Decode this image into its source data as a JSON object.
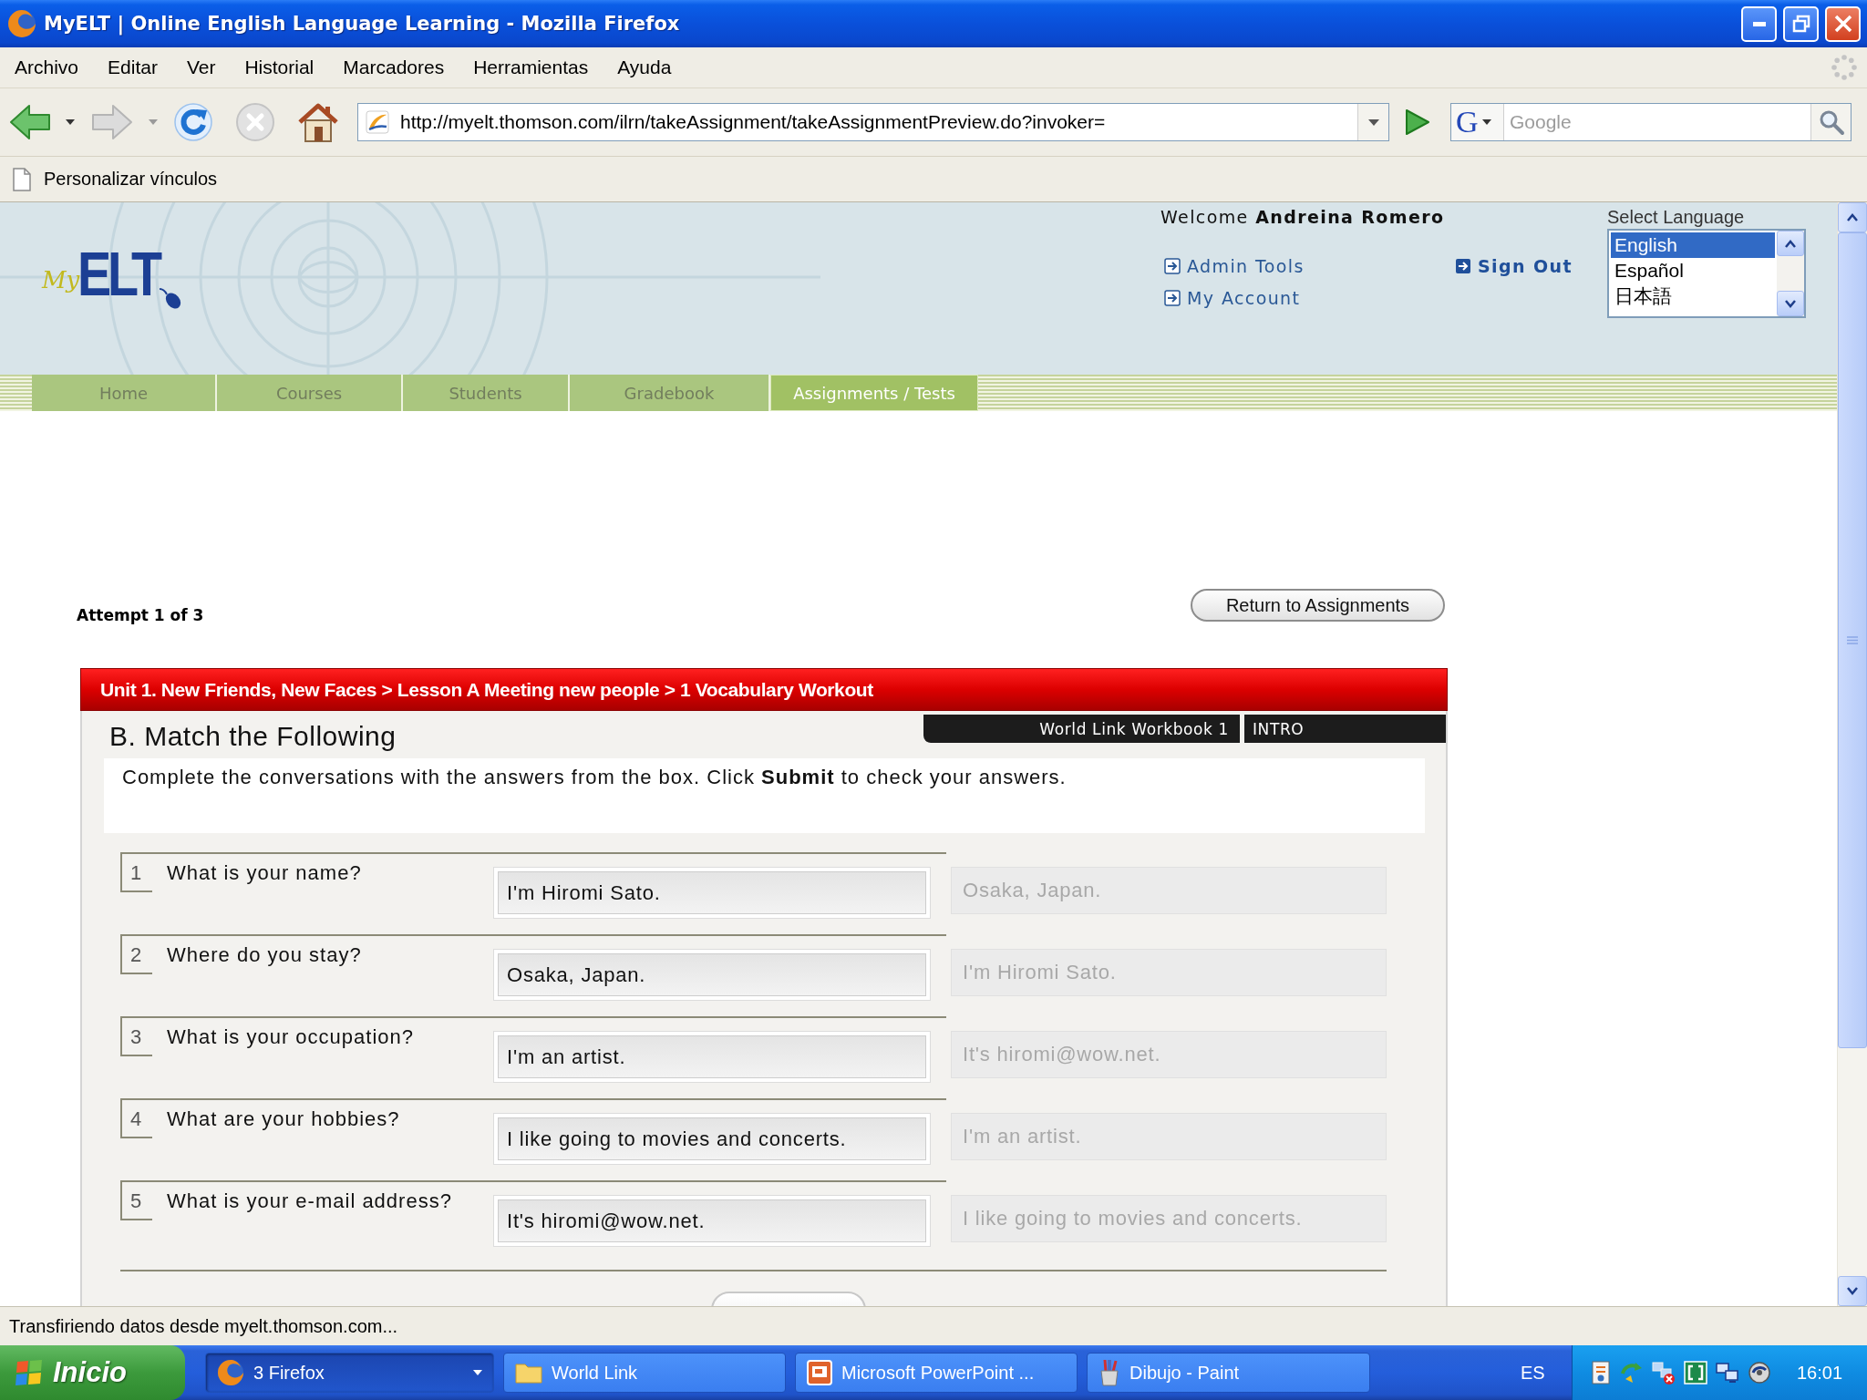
{
  "window": {
    "title": "MyELT | Online English Language Learning - Mozilla Firefox"
  },
  "menu_bar": [
    "Archivo",
    "Editar",
    "Ver",
    "Historial",
    "Marcadores",
    "Herramientas",
    "Ayuda"
  ],
  "toolbar": {
    "url": "http://myelt.thomson.com/ilrn/takeAssignment/takeAssignmentPreview.do?invoker=",
    "search_engine_logo": "G",
    "search_placeholder": "Google"
  },
  "bookmarks_bar": [
    "Personalizar vínculos"
  ],
  "site": {
    "logo": {
      "prefix": "My",
      "name": "ELT"
    },
    "welcome": "Welcome **Andreina Romero**",
    "links": [
      "Admin Tools",
      "My Account"
    ],
    "sign_out": "Sign Out",
    "language": {
      "label": "Select Language",
      "options": [
        {
          "label": "English",
          "selected": true
        },
        {
          "label": "Español",
          "selected": false
        },
        {
          "label": "日本語",
          "selected": false
        }
      ]
    },
    "nav_tabs": [
      {
        "label": "Home",
        "selected": false
      },
      {
        "label": "Courses",
        "selected": false
      },
      {
        "label": "Students",
        "selected": false
      },
      {
        "label": "Gradebook",
        "selected": false
      },
      {
        "label": "Assignments / Tests",
        "selected": true
      }
    ]
  },
  "attempt": "Attempt 1 of 3",
  "return_button": "Return to Assignments",
  "exercise": {
    "breadcrumb": "Unit 1. New Friends, New Faces > Lesson A Meeting new people > 1 Vocabulary Workout",
    "book_tabs": [
      "World Link Workbook 1",
      "INTRO"
    ],
    "title": "B. Match the Following",
    "instructions": "Complete the conversations with the answers from the box. Click **Submit** to check your answers.",
    "rows": [
      {
        "number": "1",
        "question": "What is your name?",
        "answer": "I'm Hiromi Sato.",
        "option": {
          "label": "Osaka, Japan.",
          "disabled": true
        }
      },
      {
        "number": "2",
        "question": "Where do you stay?",
        "answer": "Osaka, Japan.",
        "option": {
          "label": "I'm Hiromi Sato.",
          "disabled": true
        }
      },
      {
        "number": "3",
        "question": "What is your occupation?",
        "answer": "I'm an artist.",
        "option": {
          "label": "It's hiromi@wow.net.",
          "disabled": true
        }
      },
      {
        "number": "4",
        "question": "What are your hobbies?",
        "answer": "I like going to movies and concerts.",
        "option": {
          "label": "I'm an artist.",
          "disabled": true
        }
      },
      {
        "number": "5",
        "question": "What is your e-mail address?",
        "answer": "It's hiromi@wow.net.",
        "option": {
          "label": "I like going to movies and concerts.",
          "disabled": true
        }
      }
    ]
  },
  "status_bar": "Transfiriendo datos desde myelt.thomson.com...",
  "taskbar": {
    "start": "Inicio",
    "tasks": [
      {
        "kind": "browser",
        "label": "3 Firefox",
        "selected": true
      },
      {
        "kind": "folder",
        "label": "World Link",
        "selected": false
      },
      {
        "kind": "slides",
        "label": "Microsoft PowerPoint ...",
        "selected": false
      },
      {
        "kind": "paint",
        "label": "Dibujo - Paint",
        "selected": false
      }
    ],
    "language": "ES",
    "clock": "16:01"
  }
}
